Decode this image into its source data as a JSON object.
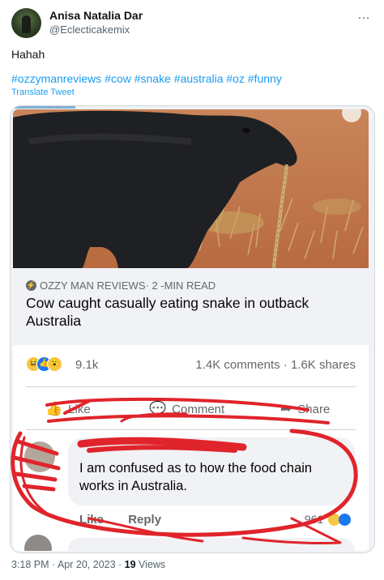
{
  "tweet": {
    "author": {
      "display_name": "Anisa Natalia Dar",
      "handle": "@Eclecticakemix"
    },
    "more_icon": "…",
    "text": "Hahah",
    "hashtags": [
      "#ozzymanreviews",
      "#cow",
      "#snake",
      "#australia",
      "#oz",
      "#funny"
    ],
    "translate_label": "Translate Tweet",
    "timestamp": "3:18 PM · Apr 20, 2023 · ",
    "views_count": "19",
    "views_label": " Views"
  },
  "embedded_post": {
    "link": {
      "source": "OZZY MAN REVIEWS",
      "read_time": " · 2 -MIN READ",
      "headline": "Cow caught casually eating snake in outback Australia"
    },
    "reactions": {
      "count": "9.1k",
      "engagement": "1.4K comments · 1.6K shares"
    },
    "actions": {
      "like": "Like",
      "comment": "Comment",
      "share": "Share"
    },
    "comment": {
      "text": "I am confused as to how the food chain works in Australia.",
      "like_label": "Like",
      "reply_label": "Reply",
      "reaction_count": "961"
    }
  },
  "colors": {
    "link_blue": "#1d9bf0",
    "annotation_red": "#e0242b",
    "fb_blue": "#1877f2",
    "muted_gray": "#536471"
  },
  "icons": {
    "avatar": "avatar",
    "more": "more-horizontal-icon",
    "source": "lightning-icon",
    "like": "thumbs-up-icon",
    "comment": "speech-bubble-icon",
    "share": "share-arrow-icon",
    "reactions": [
      "haha-reaction-icon",
      "like-reaction-icon",
      "wow-reaction-icon"
    ]
  }
}
